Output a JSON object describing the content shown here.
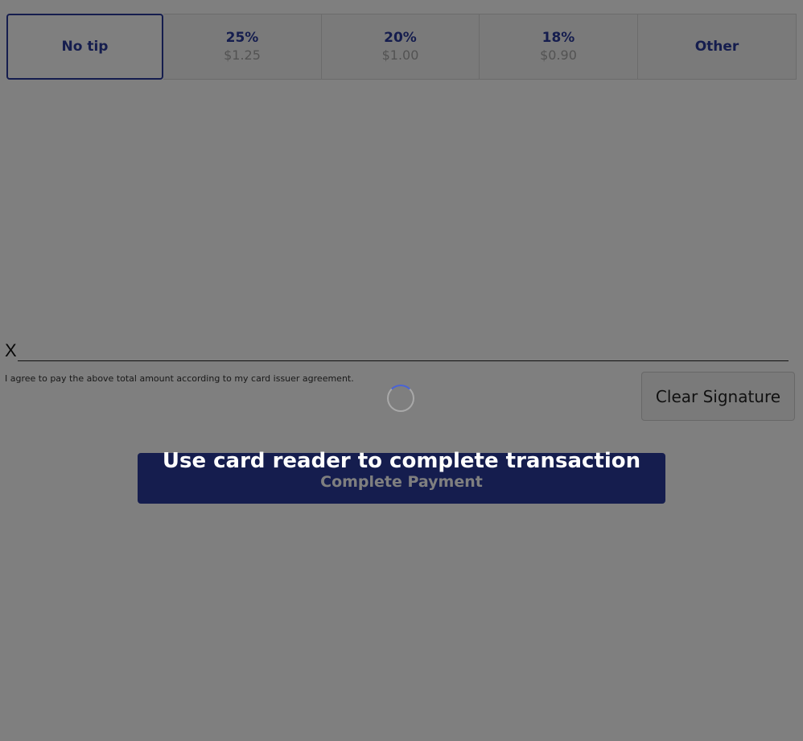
{
  "tips": {
    "options": [
      {
        "label": "No tip",
        "amount": ""
      },
      {
        "label": "25%",
        "amount": "$1.25"
      },
      {
        "label": "20%",
        "amount": "$1.00"
      },
      {
        "label": "18%",
        "amount": "$0.90"
      },
      {
        "label": "Other",
        "amount": ""
      }
    ],
    "selected_index": 0
  },
  "signature": {
    "x_mark": "X",
    "agreement_text": "I agree to pay the above total amount according to my card issuer agreement.",
    "clear_label": "Clear Signature"
  },
  "payment": {
    "complete_label": "Complete Payment"
  },
  "overlay": {
    "message": "Use card reader to complete transaction"
  },
  "colors": {
    "accent": "#2a3b9d",
    "overlay": "rgba(0,0,0,0.5)"
  },
  "icons": {
    "loading": "loading-spinner-icon"
  }
}
